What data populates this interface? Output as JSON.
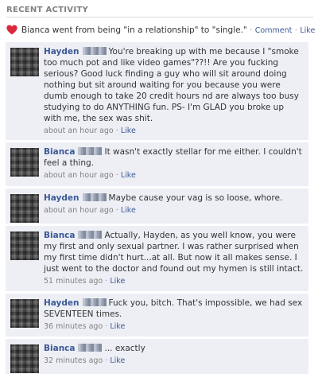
{
  "header": {
    "title": "RECENT ACTIVITY"
  },
  "story": {
    "icon": "heart-icon",
    "text": "Bianca went from being \"in a relationship\" to \"single.\"",
    "comment_label": "Comment",
    "like_label": "Like"
  },
  "comments": [
    {
      "author": "Hayden",
      "text": "You're breaking up with me because I \"smoke too much pot and like video games\"??!! Are you fucking serious? Good luck finding a guy who will sit around doing nothing but sit around waiting for you because you were dumb enough to take 20 credit hours nd are always too busy studying to do ANYTHING fun. PS- I'm GLAD you broke up with me, the sex was shit.",
      "time": "about an hour ago",
      "like": "Like"
    },
    {
      "author": "Bianca",
      "text": "It wasn't exactly stellar for me either. I couldn't feel a thing.",
      "time": "about an hour ago",
      "like": "Like"
    },
    {
      "author": "Hayden",
      "text": "Maybe cause your vag is so loose, whore.",
      "time": "about an hour ago",
      "like": "Like"
    },
    {
      "author": "Bianca",
      "text": "Actually, Hayden, as you well know, you were my first and only sexual partner. I was rather surprised when my first time didn't hurt...at all. But now it all makes sense. I just went to the doctor and found out my hymen is still intact.",
      "time": "51 minutes ago",
      "like": "Like"
    },
    {
      "author": "Hayden",
      "text": "Fuck you, bitch. That's impossible, we had sex SEVENTEEN times.",
      "time": "36 minutes ago",
      "like": "Like"
    },
    {
      "author": "Bianca",
      "text": "... exactly",
      "time": "32 minutes ago",
      "like": "Like"
    }
  ]
}
